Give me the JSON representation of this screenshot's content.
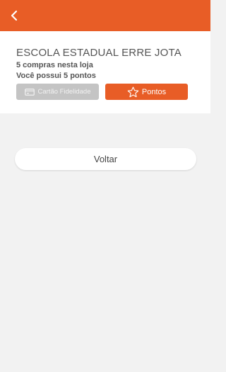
{
  "header": {
    "back_icon": "chevron-left-icon",
    "color": "#e85d26"
  },
  "store": {
    "name": "ESCOLA ESTADUAL ERRE JOTA",
    "purchases_text": "5 compras nesta loja",
    "points_text": "Você possui 5 pontos"
  },
  "actions": {
    "loyalty_card_label": "Cartão Fidelidade",
    "loyalty_card_icon": "credit-card-icon",
    "loyalty_card_disabled": true,
    "points_label": "Pontos",
    "points_icon": "star-outline-icon"
  },
  "footer": {
    "back_label": "Voltar"
  },
  "colors": {
    "accent": "#e85d26",
    "disabled": "#c4c4c4",
    "background": "#f2f2f2"
  }
}
